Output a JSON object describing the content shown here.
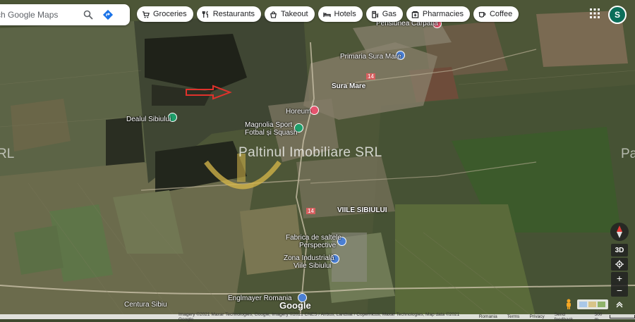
{
  "search": {
    "placeholder": "ch Google Maps"
  },
  "chips": [
    {
      "label": "Groceries",
      "icon": "cart-icon"
    },
    {
      "label": "Restaurants",
      "icon": "fork-knife-icon"
    },
    {
      "label": "Takeout",
      "icon": "takeout-icon"
    },
    {
      "label": "Hotels",
      "icon": "bed-icon"
    },
    {
      "label": "Gas",
      "icon": "gas-pump-icon"
    },
    {
      "label": "Pharmacies",
      "icon": "pharmacy-icon"
    },
    {
      "label": "Coffee",
      "icon": "coffee-icon"
    }
  ],
  "account": {
    "initial": "S"
  },
  "places": {
    "pensiunea": "Pensiunea Carpatia",
    "primaria": "Primaria Sura Mare",
    "sura_mare": "Sura Mare",
    "horeum": "Horeum",
    "magnolia1": "Magnolia Sport",
    "magnolia2": "Fotbal și Squash",
    "dealul": "Dealul Sibiului",
    "viile": "VIILE SIBIULUI",
    "fabrica1": "Fabrica de saltele",
    "fabrica2": "Perspective",
    "zona1": "Zona Industrială",
    "zona2": "Viile Sibiului",
    "englmayer": "Englmayer Romania",
    "centura": "Centura Sibiu",
    "road14a": "14",
    "road14b": "14"
  },
  "watermark": {
    "text": "Paltinul Imobiliare SRL",
    "right": "Pa",
    "left": "RL"
  },
  "controls": {
    "compass": "compass-icon",
    "view3d": "3D",
    "zoom_in": "+",
    "zoom_out": "−",
    "locate": "locate-icon"
  },
  "brand": "Google",
  "footer": {
    "imagery": "Imagery ©2021 Maxar Technologies, Google, Imagery ©2021 CNES / Airbus, Landsat / Copernicus, Maxar Technologies, Map data ©2021 Google",
    "country": "Romania",
    "terms": "Terms",
    "privacy": "Privacy",
    "feedback": "Send feedback",
    "scale": "500 m"
  },
  "colors": {
    "pin_red": "#e5546e",
    "pin_green": "#1e9e6a",
    "pin_blue": "#4a7fd4",
    "arrow": "#e0322c",
    "accent": "#1a73e8"
  }
}
